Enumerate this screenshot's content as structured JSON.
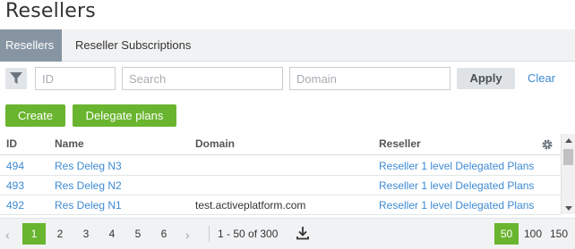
{
  "page": {
    "title": "Resellers"
  },
  "tabs": [
    {
      "label": "Resellers",
      "active": true
    },
    {
      "label": "Reseller Subscriptions",
      "active": false
    }
  ],
  "filters": {
    "id_placeholder": "ID",
    "search_placeholder": "Search",
    "domain_placeholder": "Domain",
    "apply_label": "Apply",
    "clear_label": "Clear"
  },
  "actions": {
    "create_label": "Create",
    "delegate_label": "Delegate plans"
  },
  "table": {
    "columns": [
      "ID",
      "Name",
      "Domain",
      "Reseller"
    ],
    "rows": [
      {
        "id": "494",
        "name": "Res Deleg N3",
        "domain": "",
        "reseller": "Reseller 1 level Delegated Plans"
      },
      {
        "id": "493",
        "name": "Res Deleg N2",
        "domain": "",
        "reseller": "Reseller 1 level Delegated Plans"
      },
      {
        "id": "492",
        "name": "Res Deleg N1",
        "domain": "test.activeplatform.com",
        "reseller": "Reseller 1 level Delegated Plans"
      }
    ]
  },
  "pagination": {
    "pages": [
      "1",
      "2",
      "3",
      "4",
      "5",
      "6"
    ],
    "current_page": "1",
    "range_text": "1 - 50 of 300",
    "page_sizes": [
      "50",
      "100",
      "150"
    ],
    "current_size": "50"
  },
  "colors": {
    "accent_green": "#6ab52f",
    "link_blue": "#3e8ad3",
    "tab_active": "#8795a3"
  },
  "icons": [
    "filter-icon",
    "settings-gear-icon",
    "download-icon",
    "chevron-left-icon",
    "chevron-right-icon"
  ]
}
